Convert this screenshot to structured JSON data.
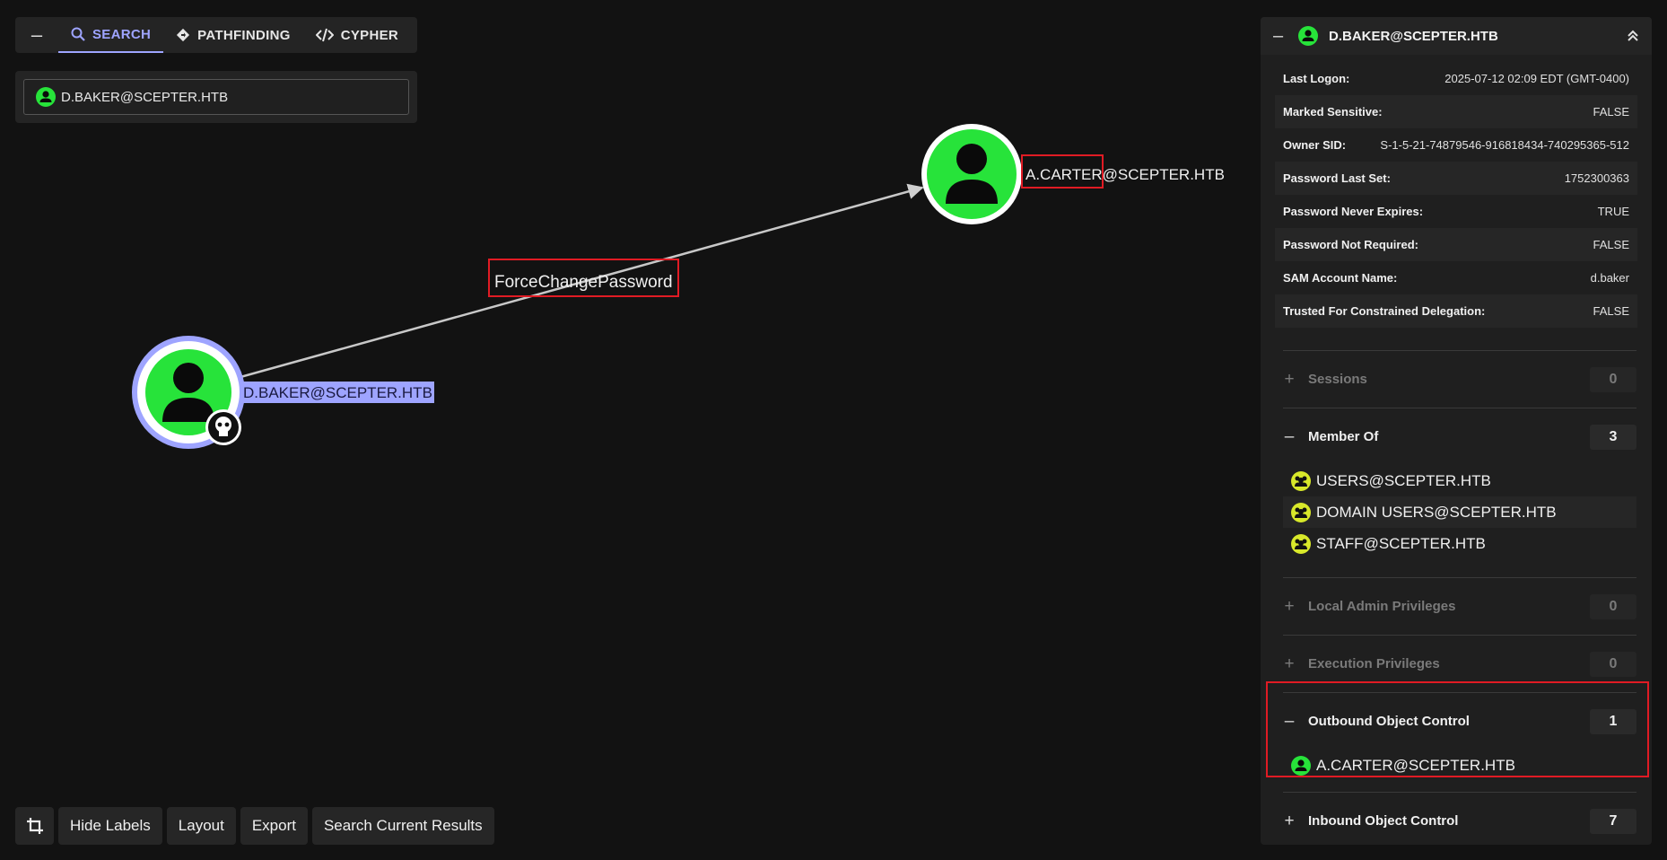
{
  "nav": {
    "collapse_label": "–",
    "tabs": [
      {
        "label": "SEARCH",
        "icon": "search-icon",
        "active": true
      },
      {
        "label": "PATHFINDING",
        "icon": "diamond-arrow-icon",
        "active": false
      },
      {
        "label": "CYPHER",
        "icon": "code-icon",
        "active": false
      }
    ]
  },
  "search": {
    "value": "D.BAKER@SCEPTER.HTB",
    "icon": "user-icon"
  },
  "graph": {
    "nodes": [
      {
        "id": "source",
        "label": "D.BAKER@SCEPTER.HTB",
        "type": "User",
        "owned": true,
        "selected": true
      },
      {
        "id": "target",
        "label_highlight": "A.CARTER",
        "label_rest": "@SCEPTER.HTB",
        "type": "User"
      }
    ],
    "edge": {
      "label": "ForceChangePassword"
    }
  },
  "toolbar": {
    "crop_icon": "crop-icon",
    "buttons": [
      "Hide Labels",
      "Layout",
      "Export",
      "Search Current Results"
    ]
  },
  "panel": {
    "title": "D.BAKER@SCEPTER.HTB",
    "collapse_label": "–",
    "properties": [
      {
        "key": "Last Logon:",
        "value": "2025-07-12 02:09 EDT (GMT-0400)"
      },
      {
        "key": "Marked Sensitive:",
        "value": "FALSE"
      },
      {
        "key": "Owner SID:",
        "value": "S-1-5-21-74879546-916818434-740295365-512"
      },
      {
        "key": "Password Last Set:",
        "value": "1752300363"
      },
      {
        "key": "Password Never Expires:",
        "value": "TRUE"
      },
      {
        "key": "Password Not Required:",
        "value": "FALSE"
      },
      {
        "key": "SAM Account Name:",
        "value": "d.baker"
      },
      {
        "key": "Trusted For Constrained Delegation:",
        "value": "FALSE"
      }
    ],
    "sections": [
      {
        "label": "Sessions",
        "count": "0",
        "expanded": false,
        "items": []
      },
      {
        "label": "Member Of",
        "count": "3",
        "expanded": true,
        "items": [
          "USERS@SCEPTER.HTB",
          "DOMAIN USERS@SCEPTER.HTB",
          "STAFF@SCEPTER.HTB"
        ],
        "item_icon": "group-icon"
      },
      {
        "label": "Local Admin Privileges",
        "count": "0",
        "expanded": false,
        "items": []
      },
      {
        "label": "Execution Privileges",
        "count": "0",
        "expanded": false,
        "items": []
      },
      {
        "label": "Outbound Object Control",
        "count": "1",
        "expanded": true,
        "items": [
          "A.CARTER@SCEPTER.HTB"
        ],
        "item_icon": "user-icon"
      },
      {
        "label": "Inbound Object Control",
        "count": "7",
        "expanded": false,
        "items": []
      }
    ],
    "expand_symbol": "+",
    "collapse_symbol": "–"
  },
  "colors": {
    "user_green": "#27e33a",
    "group_yellow": "#d8e82a",
    "accent": "#9ea4ff",
    "highlight_red": "#e01b24"
  }
}
